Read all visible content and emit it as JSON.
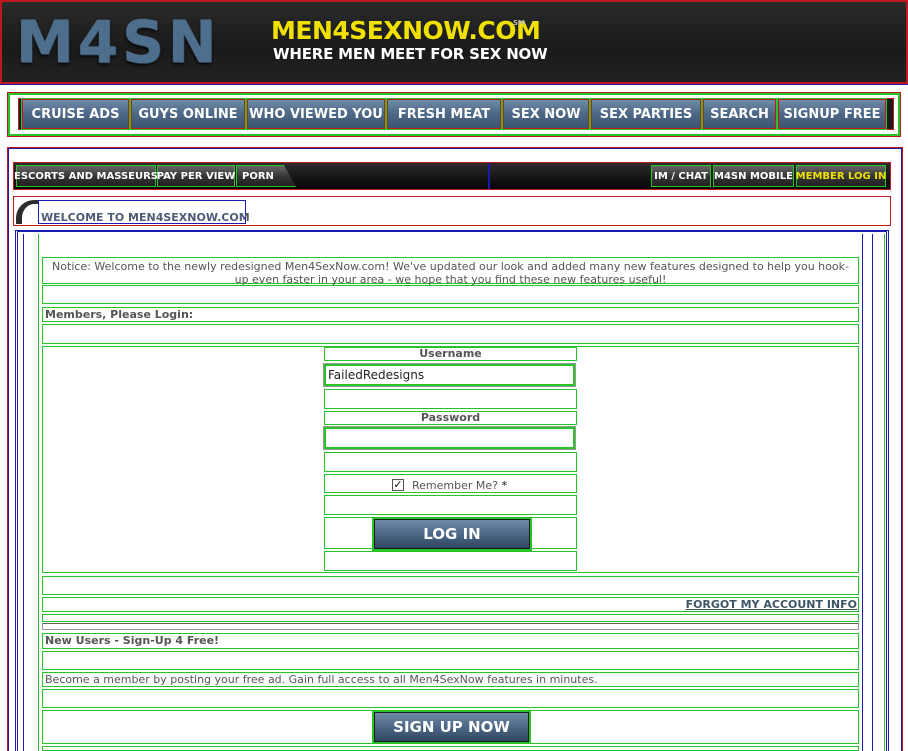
{
  "header": {
    "logo": "M4SN",
    "domain": "MEN4SEXNOW.COM",
    "service_mark": "SM",
    "tagline": "WHERE MEN MEET FOR SEX NOW"
  },
  "main_nav": [
    {
      "label": "CRUISE ADS"
    },
    {
      "label": "GUYS ONLINE"
    },
    {
      "label": "WHO VIEWED YOU"
    },
    {
      "label": "FRESH MEAT"
    },
    {
      "label": "SEX NOW"
    },
    {
      "label": "SEX PARTIES"
    },
    {
      "label": "SEARCH"
    },
    {
      "label": "SIGNUP FREE"
    }
  ],
  "sub_nav": {
    "left": [
      {
        "label": "ESCORTS AND MASSEURS"
      },
      {
        "label": "PAY PER VIEW"
      },
      {
        "label": "PORN"
      }
    ],
    "right": [
      {
        "label": "IM / CHAT"
      },
      {
        "label": "M4SN MOBILE"
      },
      {
        "label": "MEMBER LOG IN"
      }
    ]
  },
  "welcome": {
    "title": "WELCOME TO MEN4SEXNOW.COM"
  },
  "notice": "Notice: Welcome to the newly redesigned Men4SexNow.com! We've updated our look and added many new features designed to help you hook-up even faster in your area - we hope that you find these new features useful!",
  "login": {
    "heading": "Members, Please Login:",
    "username_label": "Username",
    "username_value": "FailedRedesigns",
    "password_label": "Password",
    "password_value": "",
    "remember_label": "Remember Me?",
    "remember_required": "*",
    "remember_checked": true,
    "login_button": "LOG IN",
    "forgot_link": "FORGOT MY ACCOUNT INFO"
  },
  "signup": {
    "heading": "New Users - Sign-Up 4 Free!",
    "description": "Become a member by posting your free ad. Gain full access to all Men4SexNow features in minutes.",
    "button": "SIGN UP NOW"
  },
  "colors": {
    "accent_blue": "#4d6886",
    "logo_yellow": "#f0e100",
    "debug_green": "#27c427",
    "debug_red": "#c0181e",
    "debug_blue": "#1b1bb0",
    "sub_nav_highlight": "#f0e100"
  }
}
